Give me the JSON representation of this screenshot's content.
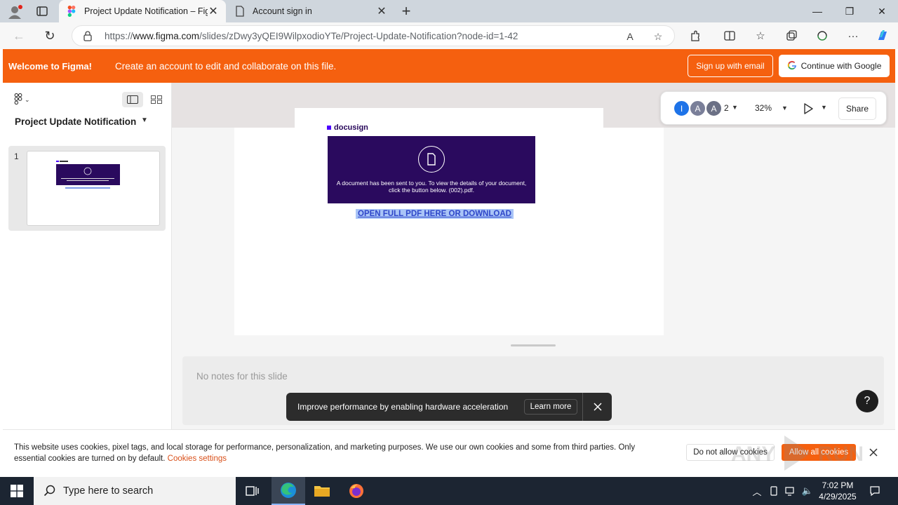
{
  "browser": {
    "tabs": [
      {
        "title": "Project Update Notification – Fig",
        "active": true
      },
      {
        "title": "Account sign in",
        "active": false
      }
    ],
    "url_prefix": "https://",
    "url_host": "www.figma.com",
    "url_path": "/slides/zDwy3yQEI9WilpxodioYTe/Project-Update-Notification?node-id=1-42"
  },
  "banner": {
    "welcome": "Welcome to Figma!",
    "message": "Create an account to edit and collaborate on this file.",
    "signup_label": "Sign up with email",
    "google_label": "Continue with Google"
  },
  "left_panel": {
    "file_title": "Project Update Notification",
    "slide_number": "1"
  },
  "toolbar": {
    "avatars": [
      {
        "letter": "I",
        "color": "#1e73e8"
      },
      {
        "letter": "A",
        "color": "#7a7f99"
      },
      {
        "letter": "A",
        "color": "#6b7085"
      }
    ],
    "count": "2",
    "zoom": "32%",
    "share_label": "Share"
  },
  "slide": {
    "logo_text": "docusign",
    "card_message": "A document has been sent to you. To view the details of your document, click the button below. (002).pdf.",
    "link_text": "OPEN FULL PDF HERE OR DOWNLOAD"
  },
  "notes": {
    "placeholder": "No notes for this slide"
  },
  "toast": {
    "message": "Improve performance by enabling hardware acceleration",
    "learn_more": "Learn more"
  },
  "cookie": {
    "text": "This website uses cookies, pixel tags, and local storage for performance, personalization, and marketing purposes. We use our own cookies and some from third parties. Only essential cookies are turned on by default.",
    "settings_link": "Cookies settings",
    "deny_label": "Do not allow cookies",
    "allow_label": "Allow all cookies"
  },
  "taskbar": {
    "search_placeholder": "Type here to search",
    "time": "7:02 PM",
    "date": "4/29/2025"
  },
  "colors": {
    "figma_orange": "#f5600f",
    "docusign_purple": "#2a0a5e",
    "taskbar": "#1c2532"
  }
}
